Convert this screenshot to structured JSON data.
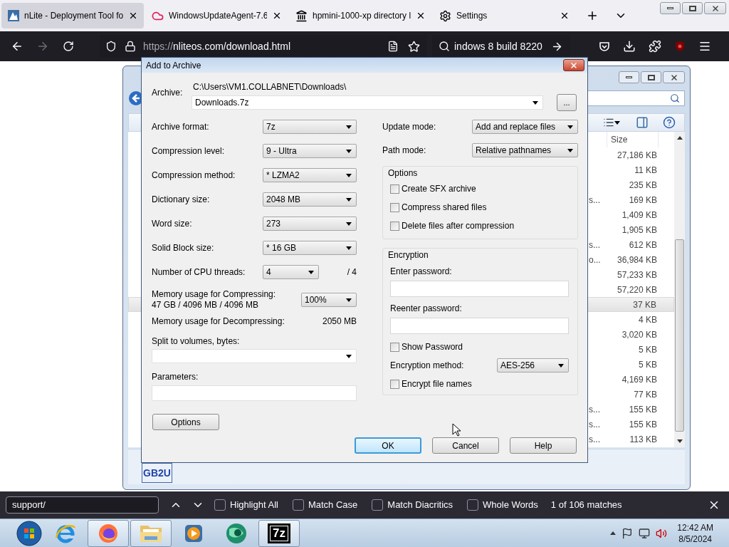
{
  "browser": {
    "tabs": [
      {
        "kind": "nlite",
        "title": "nLite - Deployment Tool fo",
        "selected": true
      },
      {
        "kind": "cloud",
        "title": "WindowsUpdateAgent-7.6",
        "selected": false
      },
      {
        "kind": "landmark",
        "title": "hpmini-1000-xp directory l",
        "selected": false
      },
      {
        "kind": "gear",
        "title": "Settings",
        "selected": false
      }
    ],
    "url_scheme": "https://",
    "url_rest": "nliteos.com/download.html",
    "search_value": "indows 8 build 8220"
  },
  "explorer": {
    "size_header": "Size",
    "thumbnail_text": "GB2U",
    "rows": [
      {
        "size": "27,186 KB",
        "selected": false
      },
      {
        "size": "11 KB",
        "selected": false
      },
      {
        "size": "235 KB",
        "selected": false
      },
      {
        "fragment": "s...",
        "size": "169 KB",
        "selected": false
      },
      {
        "size": "1,409 KB",
        "selected": false
      },
      {
        "size": "1,905 KB",
        "selected": false
      },
      {
        "fragment": "s...",
        "size": "612 KB",
        "selected": false
      },
      {
        "fragment": "o...",
        "size": "36,984 KB",
        "selected": false
      },
      {
        "size": "57,233 KB",
        "selected": false
      },
      {
        "size": "57,220 KB",
        "selected": false
      },
      {
        "size": "37 KB",
        "selected": true
      },
      {
        "size": "4 KB",
        "selected": false
      },
      {
        "size": "3,020 KB",
        "selected": false
      },
      {
        "size": "5 KB",
        "selected": false
      },
      {
        "size": "5 KB",
        "selected": false
      },
      {
        "size": "4,169 KB",
        "selected": false
      },
      {
        "size": "77 KB",
        "selected": false
      },
      {
        "fragment": "s...",
        "size": "155 KB",
        "selected": false
      },
      {
        "fragment": "s...",
        "size": "155 KB",
        "selected": false
      },
      {
        "fragment": "s...",
        "size": "113 KB",
        "selected": false
      }
    ]
  },
  "dialog": {
    "title": "Add to Archive",
    "archive_label": "Archive:",
    "archive_path": "C:\\Users\\VM1.COLLABNET\\Downloads\\",
    "archive_name": "Downloads.7z",
    "browse": "...",
    "left_rows": [
      {
        "label": "Archive format:",
        "value": "7z"
      },
      {
        "label": "Compression level:",
        "value": "9 - Ultra"
      },
      {
        "label": "Compression method:",
        "value": "* LZMA2"
      },
      {
        "label": "Dictionary size:",
        "value": "2048 MB"
      },
      {
        "label": "Word size:",
        "value": "273"
      },
      {
        "label": "Solid Block size:",
        "value": "* 16 GB"
      }
    ],
    "threads": {
      "label": "Number of CPU threads:",
      "value": "4",
      "max": "/ 4"
    },
    "mem_compress": {
      "label": "Memory usage for Compressing:",
      "detail": "47 GB / 4096 MB / 4096 MB",
      "value": "100%"
    },
    "mem_decompress": {
      "label": "Memory usage for Decompressing:",
      "value": "2050 MB"
    },
    "split_label": "Split to volumes, bytes:",
    "parameters_label": "Parameters:",
    "options_button": "Options",
    "right_rows": [
      {
        "label": "Update mode:",
        "value": "Add and replace files"
      },
      {
        "label": "Path mode:",
        "value": "Relative pathnames"
      }
    ],
    "options_group": {
      "title": "Options",
      "items": [
        {
          "label": "Create SFX archive",
          "checked": false
        },
        {
          "label": "Compress shared files",
          "checked": false
        },
        {
          "label": "Delete files after compression",
          "checked": false
        }
      ]
    },
    "encryption": {
      "title": "Encryption",
      "enter_label": "Enter password:",
      "reenter_label": "Reenter password:",
      "show_password": {
        "label": "Show Password",
        "checked": false
      },
      "method_label": "Encryption method:",
      "method": "AES-256",
      "encrypt_names": {
        "label": "Encrypt file names",
        "checked": false
      }
    },
    "buttons": [
      {
        "label": "OK",
        "default": true
      },
      {
        "label": "Cancel",
        "default": false
      },
      {
        "label": "Help",
        "default": false
      }
    ]
  },
  "find_bar": {
    "value": "support/",
    "options": [
      {
        "label": "Highlight All",
        "checked": false
      },
      {
        "label": "Match Case",
        "checked": false
      },
      {
        "label": "Match Diacritics",
        "checked": false
      },
      {
        "label": "Whole Words",
        "checked": false
      }
    ],
    "status": "1 of 106 matches"
  },
  "taskbar": {
    "apps": [
      {
        "kind": "ie",
        "active": false
      },
      {
        "kind": "firefox",
        "active": true
      },
      {
        "kind": "folder",
        "active": true
      },
      {
        "kind": "media",
        "active": false
      },
      {
        "kind": "globe",
        "active": false
      },
      {
        "kind": "sevenzip",
        "label": "7z",
        "active": true
      }
    ],
    "time": "12:42 AM",
    "date": "8/5/2024"
  }
}
